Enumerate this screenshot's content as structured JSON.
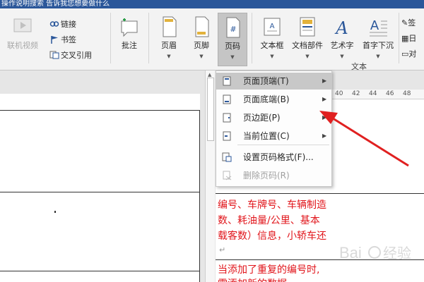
{
  "title_bar": {
    "text": "操作说明搜索 告诉我您想要做什么"
  },
  "ribbon": {
    "links_group": {
      "online_video": "联机视频",
      "link": "链接",
      "bookmark": "书签",
      "cross_reference": "交叉引用"
    },
    "comments_group": {
      "comment": "批注"
    },
    "header_footer_group": {
      "header": "页眉",
      "footer": "页脚",
      "page_number": "页码"
    },
    "text_group": {
      "text_box": "文本框",
      "quick_parts": "文档部件",
      "wordart": "艺术字",
      "drop_cap": "首字下沉",
      "label": "文本"
    },
    "right_items": {
      "signature": "签",
      "date": "日",
      "object": "对"
    }
  },
  "dropdown": {
    "items": [
      {
        "label": "页面顶端(T)",
        "has_submenu": true,
        "highlighted": true,
        "enabled": true
      },
      {
        "label": "页面底端(B)",
        "has_submenu": true,
        "highlighted": false,
        "enabled": true
      },
      {
        "label": "页边距(P)",
        "has_submenu": true,
        "highlighted": false,
        "enabled": true
      },
      {
        "label": "当前位置(C)",
        "has_submenu": true,
        "highlighted": false,
        "enabled": true
      },
      {
        "label": "设置页码格式(F)...",
        "has_submenu": false,
        "highlighted": false,
        "enabled": true
      },
      {
        "label": "删除页码(R)",
        "has_submenu": false,
        "highlighted": false,
        "enabled": false
      }
    ]
  },
  "ruler": {
    "ticks": [
      "40",
      "42",
      "44",
      "46",
      "48"
    ]
  },
  "document": {
    "lines": [
      "编号、车牌号、车辆制造",
      "数、耗油量/公里、基本",
      "载客数）信息，小轿车还",
      "当添加了重复的编号时,",
      "需添加新的数据,"
    ],
    "para_mark": "↵"
  },
  "colors": {
    "title_bar": "#2b579a",
    "ribbon_bg": "#f3f3f3",
    "document_text": "#e1151b",
    "annotation_arrow": "#e02020",
    "icon_blue": "#2b579a"
  },
  "icons": {
    "link": "link-icon",
    "bookmark": "flag-icon",
    "cross_reference": "cross-reference-icon",
    "comment": "comment-icon",
    "header": "header-icon",
    "footer": "footer-icon",
    "page_number": "page-number-icon",
    "text_box": "text-box-icon",
    "quick_parts": "quick-parts-icon",
    "wordart": "wordart-icon",
    "drop_cap": "drop-cap-icon"
  }
}
